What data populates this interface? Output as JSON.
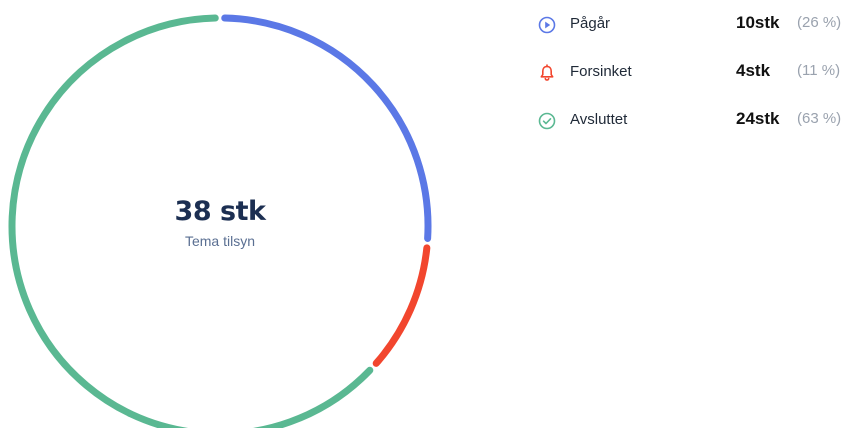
{
  "chart_data": {
    "type": "pie",
    "center_value": "38 stk",
    "center_label": "Tema tilsyn",
    "series": [
      {
        "name": "Pågår",
        "value": 10,
        "value_label": "10stk",
        "percent_label": "(26 %)",
        "color": "#5b78e6",
        "icon": "play-circle-icon"
      },
      {
        "name": "Forsinket",
        "value": 4,
        "value_label": "4stk",
        "percent_label": "(11 %)",
        "color": "#f2462e",
        "icon": "bell-icon"
      },
      {
        "name": "Avsluttet",
        "value": 24,
        "value_label": "24stk",
        "percent_label": "(63 %)",
        "color": "#5ab892",
        "icon": "check-circle-icon"
      }
    ]
  }
}
